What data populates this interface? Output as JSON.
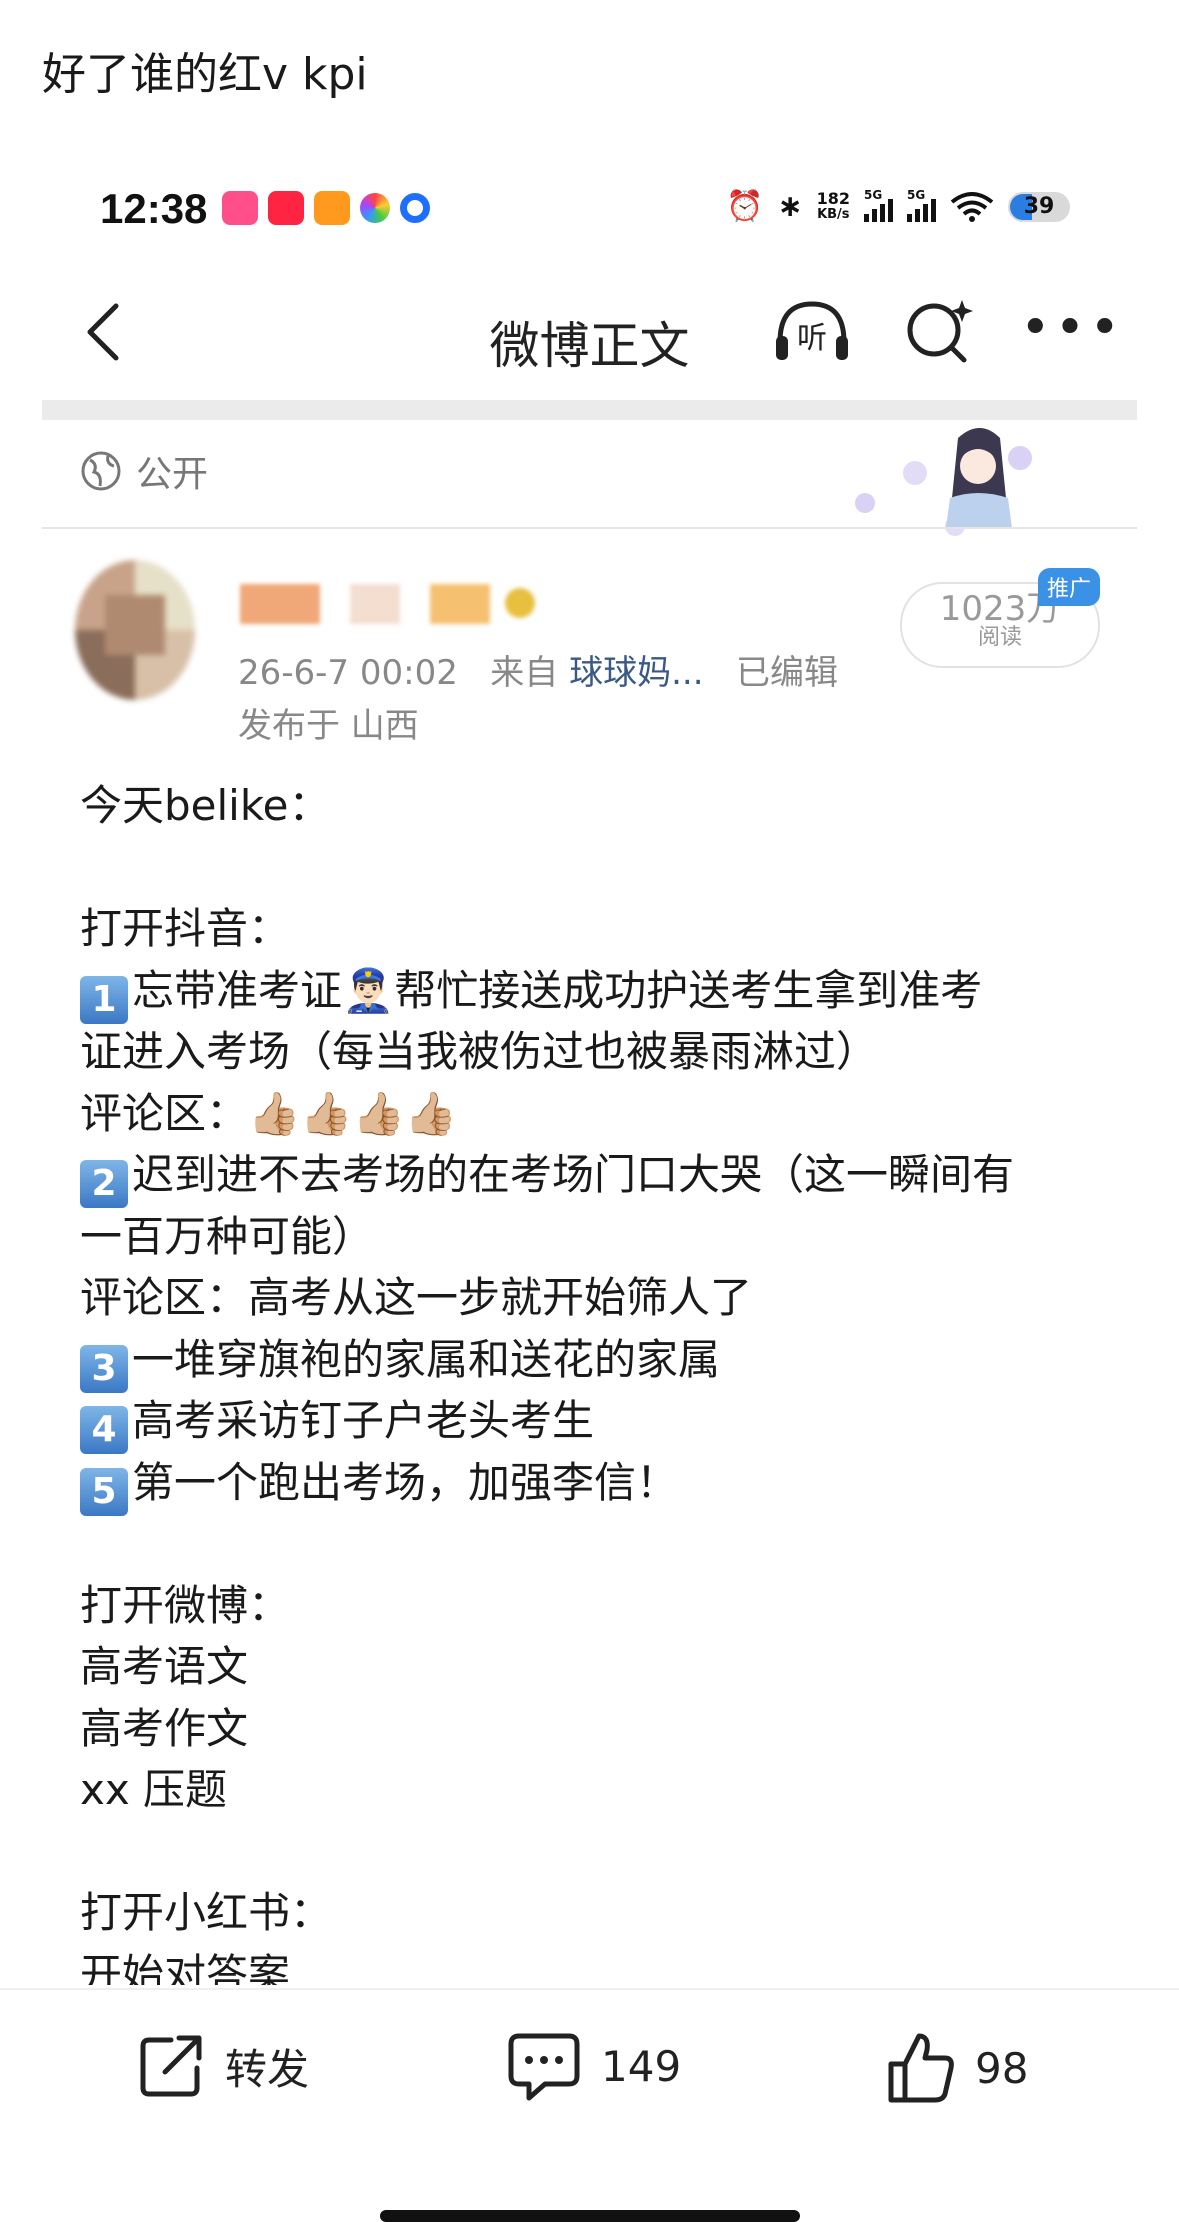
{
  "caption": "好了谁的红v kpi",
  "status_bar": {
    "time": "12:38",
    "net_speed_value": "182",
    "net_speed_unit": "KB/s",
    "signal1": "5G",
    "signal2": "5G",
    "battery": "39"
  },
  "navbar": {
    "title": "微博正文",
    "listen_label": "听"
  },
  "visibility": "公开",
  "post_meta": {
    "time": "26-6-7 00:02",
    "from_label": "来自",
    "source": "球球妈...",
    "edited": "已编辑",
    "location": "发布于 山西",
    "views": "1023万",
    "views_label": "阅读",
    "promo_badge": "推广"
  },
  "post_lines": [
    {
      "text": "今天belike："
    },
    {
      "text": ""
    },
    {
      "text": "打开抖音："
    },
    {
      "num": "1",
      "text": "忘带准考证👮🏻‍♂️帮忙接送成功护送考生拿到准考"
    },
    {
      "text": "证进入考场（每当我被伤过也被暴雨淋过）"
    },
    {
      "text": "评论区：👍🏼👍🏼👍🏼👍🏼"
    },
    {
      "num": "2",
      "text": "迟到进不去考场的在考场门口大哭（这一瞬间有"
    },
    {
      "text": "一百万种可能）"
    },
    {
      "text": "评论区：高考从这一步就开始筛人了"
    },
    {
      "num": "3",
      "text": "一堆穿旗袍的家属和送花的家属"
    },
    {
      "num": "4",
      "text": "高考采访钉子户老头考生"
    },
    {
      "num": "5",
      "text": "第一个跑出考场，加强李信！"
    },
    {
      "text": ""
    },
    {
      "text": "打开微博："
    },
    {
      "text": "高考语文"
    },
    {
      "text": "高考作文"
    },
    {
      "text": "xx 压题"
    },
    {
      "text": ""
    },
    {
      "text": "打开小红书："
    },
    {
      "text": "开始对答案"
    }
  ],
  "actions": {
    "repost": "转发",
    "comments": "149",
    "likes": "98"
  },
  "icons": {
    "back": "back-chevron-icon",
    "listen": "headphones-icon",
    "search": "search-sparkle-icon",
    "more": "more-dots-icon",
    "globe": "globe-icon",
    "repost": "share-out-icon",
    "comment": "comment-bubble-icon",
    "like": "thumbs-up-icon"
  },
  "colors": {
    "link": "#3a5a85",
    "promo": "#3b91e6",
    "muted": "#888888"
  }
}
